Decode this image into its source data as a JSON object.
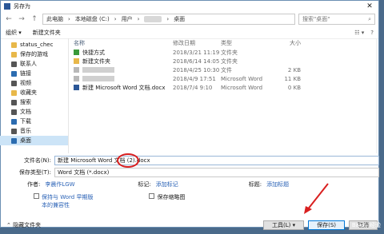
{
  "window": {
    "title": "另存为"
  },
  "address": {
    "parts": [
      "此电脑",
      "本地磁盘 (C:)",
      "用户",
      "桌面"
    ],
    "search_placeholder": "搜索\"桌面\""
  },
  "toolbar": {
    "organize": "组织 ▾",
    "new_folder": "新建文件夹"
  },
  "sidebar": {
    "items": [
      {
        "label": "status_chec",
        "color": "#e8b84a"
      },
      {
        "label": "保存的游戏",
        "color": "#e8b84a"
      },
      {
        "label": "联系人",
        "color": "#555"
      },
      {
        "label": "链接",
        "color": "#2b6cb0"
      },
      {
        "label": "视频",
        "color": "#555"
      },
      {
        "label": "收藏夹",
        "color": "#e8b84a"
      },
      {
        "label": "搜索",
        "color": "#555"
      },
      {
        "label": "文档",
        "color": "#555"
      },
      {
        "label": "下载",
        "color": "#2b6cb0"
      },
      {
        "label": "音乐",
        "color": "#555"
      },
      {
        "label": "桌面",
        "color": "#2b6cb0"
      }
    ]
  },
  "columns": {
    "name": "名称",
    "modified": "修改日期",
    "type": "类型",
    "size": "大小"
  },
  "files": [
    {
      "name": "快捷方式",
      "date": "2018/3/21 11:19",
      "type": "文件夹",
      "size": "",
      "icon": "green"
    },
    {
      "name": "新建文件夹",
      "date": "2018/6/14 14:05",
      "type": "文件夹",
      "size": "",
      "icon": "yellow"
    },
    {
      "name": "",
      "date": "2018/4/25 10:30",
      "type": "文件",
      "size": "2 KB",
      "icon": "blur"
    },
    {
      "name": "",
      "date": "2018/4/9 17:51",
      "type": "Microsoft Word",
      "size": "11 KB",
      "icon": "blur"
    },
    {
      "name": "新建 Microsoft Word 文档.docx",
      "date": "2018/7/4 9:10",
      "type": "Microsoft Word",
      "size": "0 KB",
      "icon": "word"
    }
  ],
  "form": {
    "filename_label": "文件名(N):",
    "filename_value": "新建 Microsoft Word 文档 (2).docx",
    "savetype_label": "保存类型(T):",
    "savetype_value": "Word 文档 (*.docx)",
    "author_label": "作者:",
    "author_value": "李晨作LGW",
    "tags_label": "标记:",
    "tags_value": "添加标记",
    "title_label": "标题:",
    "title_value": "添加标题",
    "compat_label_1": "保持与 Word 早期版",
    "compat_label_2": "本的兼容性",
    "thumb_label": "保存缩略图"
  },
  "footer": {
    "hide_folders": "隐藏文件夹",
    "tools": "工具(L) ▾",
    "save": "保存(S)",
    "cancel": "取消"
  },
  "watermark": "Baidu 经验"
}
